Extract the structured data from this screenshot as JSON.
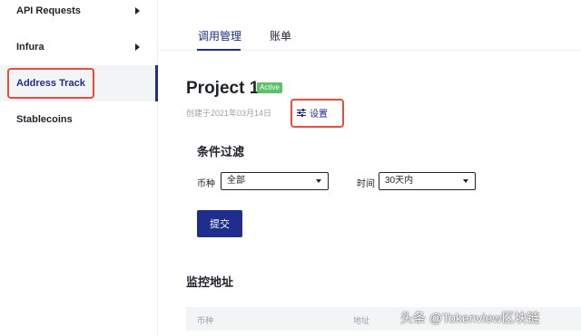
{
  "sidebar": {
    "items": [
      {
        "label": "API Requests"
      },
      {
        "label": "Infura"
      },
      {
        "label": "Address Track"
      },
      {
        "label": "Stablecoins"
      }
    ]
  },
  "tabs": [
    {
      "label": "调用管理"
    },
    {
      "label": "账单"
    }
  ],
  "project": {
    "title": "Project 1",
    "status": "Active",
    "created": "创建于2021年03月14日",
    "settings_label": "设置"
  },
  "filter": {
    "title": "条件过滤",
    "currency_label": "币种",
    "currency_value": "全部",
    "time_label": "时间",
    "time_value": "30天内",
    "submit_label": "提交"
  },
  "monitor": {
    "title": "监控地址",
    "columns": [
      "币种",
      "地址"
    ]
  },
  "watermark": "头条 @Tokenview区块链",
  "colors": {
    "accent": "#1f2d8c",
    "highlight": "#e74c3c",
    "badge": "#5cc26a"
  }
}
